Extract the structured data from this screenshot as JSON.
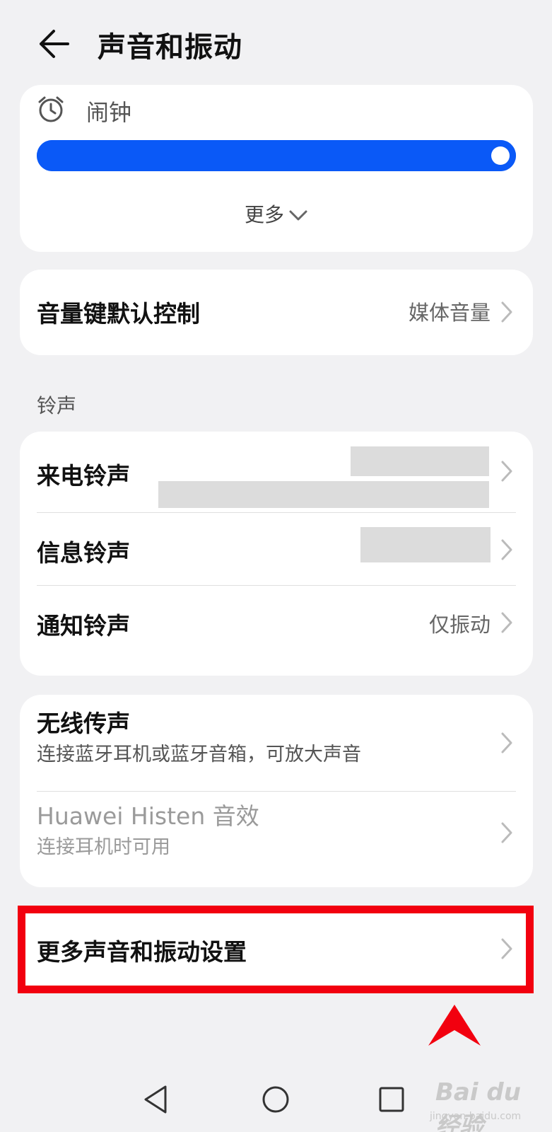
{
  "header": {
    "title": "声音和振动"
  },
  "alarm": {
    "label": "闹钟",
    "level": 1.0,
    "more_label": "更多"
  },
  "volume_key": {
    "label": "音量键默认控制",
    "value": "媒体音量"
  },
  "ringtones": {
    "section_title": "铃声",
    "items": [
      {
        "label": "来电铃声",
        "value_redacted": true
      },
      {
        "label": "信息铃声",
        "value_redacted": true
      },
      {
        "label": "通知铃声",
        "value": "仅振动"
      }
    ]
  },
  "audio": {
    "wireless": {
      "label": "无线传声",
      "sub": "连接蓝牙耳机或蓝牙音箱，可放大声音"
    },
    "histen": {
      "label": "Huawei Histen 音效",
      "sub": "连接耳机时可用",
      "enabled": false
    }
  },
  "more_settings": {
    "label": "更多声音和振动设置"
  },
  "colors": {
    "accent": "#0a59f7",
    "highlight": "#f2000f",
    "background": "#f1f1f3"
  },
  "icons": {
    "back": "back-arrow-icon",
    "alarm": "alarm-clock-icon",
    "expand": "chevron-down-icon",
    "row": "chevron-right-icon",
    "nav": [
      "nav-back-icon",
      "nav-home-icon",
      "nav-recents-icon"
    ]
  },
  "watermark": {
    "text": "Bai du 经验",
    "sub": "jingyan.baidu.com"
  }
}
